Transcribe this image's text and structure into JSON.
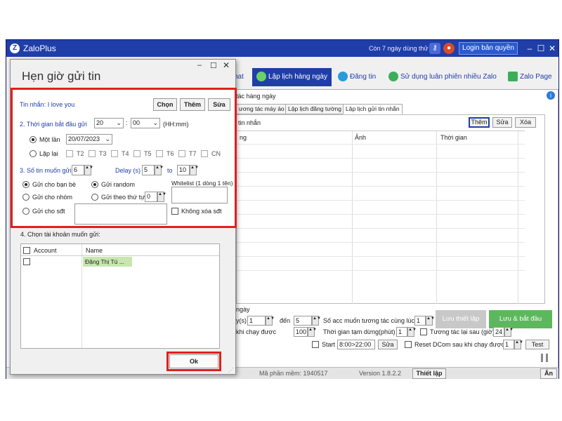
{
  "main": {
    "title": "ZaloPlus",
    "trial": "Còn 7 ngày dùng thử",
    "login_label": "Login bản quyền",
    "toolbar": {
      "hat": "hat",
      "schedule": "Lập lịch hàng ngày",
      "post": "Đăng tin",
      "rotate": "Sử dụng luân phiên nhiều Zalo",
      "page": "Zalo Page"
    },
    "section_label": "tác hàng ngày",
    "tabs": [
      "ương tác máy ảo",
      "Lập lịch đăng tường",
      "Lập lịch gửi tin nhắn"
    ],
    "grid_title": "tin nhắn",
    "grid_buttons": {
      "add": "Thêm",
      "edit": "Sửa",
      "delete": "Xóa"
    },
    "grid_headers": [
      "ng",
      "Ảnh",
      "Thời gian"
    ],
    "bottom": {
      "section": "ngày",
      "ys_label": "y(s)",
      "ys_value": "1",
      "den_label": "đến",
      "den_value": "5",
      "acc_label": "Số acc muốn tương tác cùng lúc",
      "acc_value": "1",
      "save_setting": "Lưu thiết lập",
      "save_start": "Lưu & bắt đầu",
      "run_label": "khi chạy được",
      "run_value": "100",
      "pause_label": "Thời gian tạm dừng(phút)",
      "pause_value": "1",
      "retry_label": "Tương tác lại sau (giờ)",
      "retry_value": "24",
      "start_label": "Start",
      "start_value": "8:00>22:00",
      "start_edit": "Sửa",
      "reset_label": "Reset DCom sau khi chạy được",
      "reset_value": "1",
      "test": "Test"
    },
    "status": {
      "code": "Mã phần mềm: 1940517",
      "version": "Version 1.8.2.2",
      "settings": "Thiết lập",
      "hide": "Ẩn"
    }
  },
  "dialog": {
    "title": "Hẹn giờ gửi tin",
    "message_label": "Tin nhắn: I love you",
    "btn_choose": "Chọn",
    "btn_add": "Thêm",
    "btn_edit": "Sửa",
    "start_time_label": "2. Thời gian bắt đầu gửi",
    "hour": "20",
    "minute": "00",
    "time_format": "(HH:mm)",
    "once_label": "Một lần",
    "date": "20/07/2023",
    "repeat_label": "Lặp lại",
    "days": [
      "T2",
      "T3",
      "T4",
      "T5",
      "T6",
      "T7",
      "CN"
    ],
    "count_label": "3. Số tin muốn gửi",
    "count_value": "6",
    "delay_label": "Delay (s)",
    "delay_from": "5",
    "delay_to_label": "to",
    "delay_to": "10",
    "send_friends": "Gửi cho bạn bè",
    "send_random": "Gửi random",
    "whitelist_label": "Whitelist (1 dòng 1 tên)",
    "send_group": "Gửi cho nhóm",
    "send_order": "Gửi theo thứ tự",
    "order_value": "0",
    "send_phone": "Gửi cho sđt",
    "no_delete_phone": "Không xóa sđt",
    "account_section": "4. Chọn tài khoản muốn gửi:",
    "account_headers": [
      "Account",
      "Name"
    ],
    "account_rows": [
      {
        "name": "Đặng Thị Tú ..."
      }
    ],
    "ok_label": "Ok"
  }
}
